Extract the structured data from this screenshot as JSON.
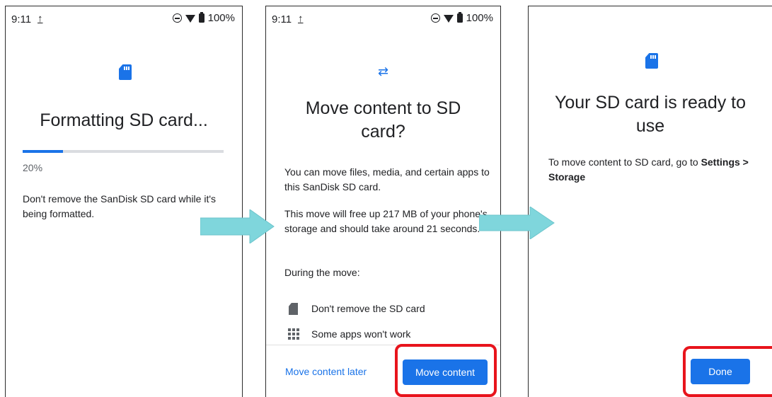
{
  "status_bar": {
    "time": "9:11",
    "upload_glyph": "↑",
    "battery": "100%"
  },
  "screen1": {
    "title": "Formatting SD card...",
    "progress_percent": 20,
    "progress_label": "20%",
    "message": "Don't remove the SanDisk SD card while it's being formatted."
  },
  "screen2": {
    "transfer_glyph": "⇄",
    "title": "Move content to SD card?",
    "para1": "You can move files, media, and certain apps to this SanDisk SD card.",
    "para2": "This move will free up 217 MB of your phone's storage and should take around 21 seconds.",
    "during": "During the move:",
    "item1": "Don't remove the SD card",
    "item2": "Some apps won't work",
    "later_button": "Move content later",
    "move_button": "Move content"
  },
  "screen3": {
    "title": "Your SD card is ready to use",
    "message_prefix": "To move content to SD card, go to ",
    "message_bold": "Settings > Storage",
    "done_button": "Done"
  },
  "colors": {
    "accent": "#1a73e8",
    "highlight": "#e8141c",
    "arrow": "#7fd6dc"
  }
}
